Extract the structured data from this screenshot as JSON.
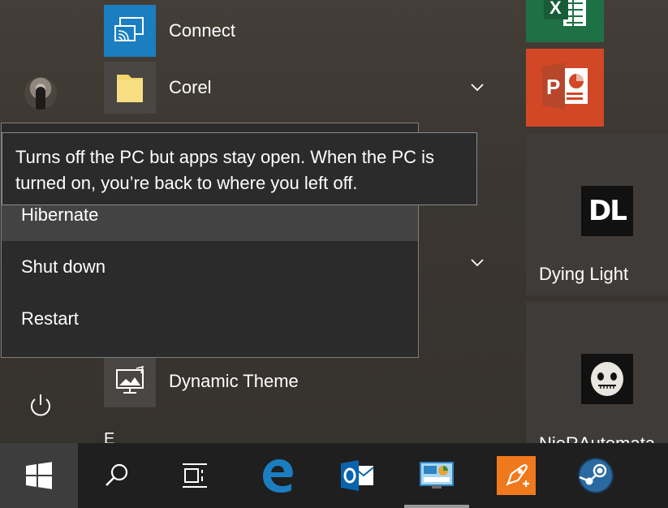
{
  "apps": [
    {
      "name": "Connect",
      "icon": "cast-icon",
      "color": "#1b7ec1"
    },
    {
      "name": "Corel",
      "icon": "folder-icon",
      "color": "#4a4643"
    },
    {
      "name": "Dynamic Theme",
      "icon": "dynamic-theme-icon",
      "color": "#4a4643"
    }
  ],
  "section_letter": "E",
  "power_menu": {
    "tooltip": "Turns off the PC but apps stay open. When the PC is turned on, you’re back to where you left off.",
    "items": [
      "Hibernate",
      "Shut down",
      "Restart"
    ],
    "hovered": "Hibernate"
  },
  "tiles": [
    {
      "name": "Excel",
      "icon": "excel-icon",
      "color": "#1e7145"
    },
    {
      "name": "PowerPoint",
      "icon": "powerpoint-icon",
      "color": "#d24726"
    },
    {
      "name": "Dying Light",
      "logo_text": "DL",
      "color": "#3f3b38"
    },
    {
      "name": "NieRAutomata",
      "color": "#3f3b38"
    }
  ],
  "taskbar": {
    "items": [
      "windows-logo-icon",
      "search-icon",
      "task-view-icon",
      "edge-icon",
      "outlook-icon",
      "control-panel-icon",
      "rocket-launcher-icon",
      "steam-icon"
    ],
    "active": "control-panel-icon"
  },
  "colors": {
    "accent": "#1b7ec1",
    "taskbar": "#1f1f1f",
    "menu": "#2b2b2b"
  }
}
